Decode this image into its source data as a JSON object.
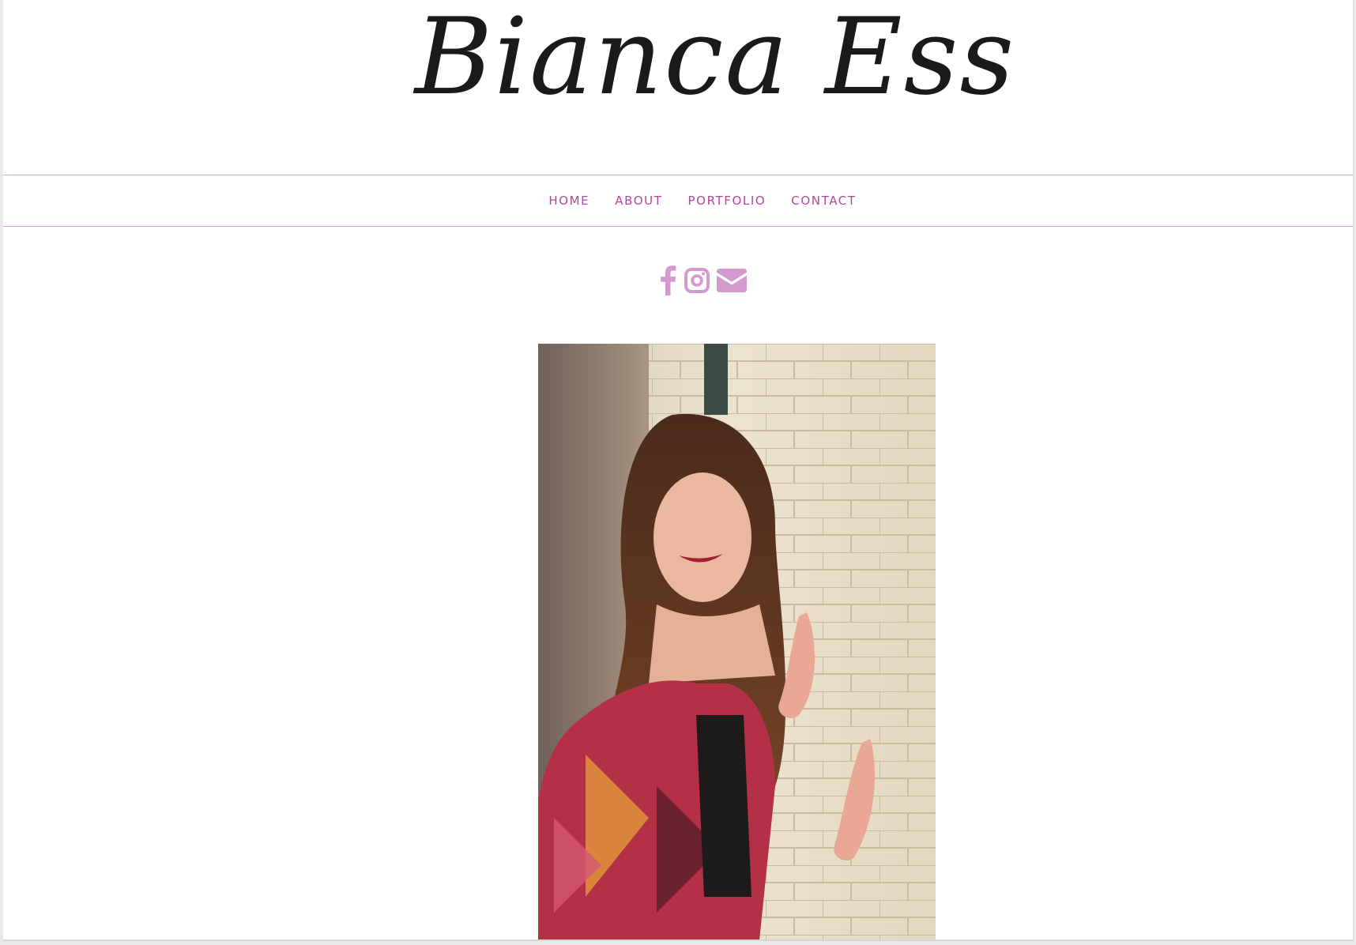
{
  "site": {
    "title": "Bianca Ess"
  },
  "nav": {
    "items": [
      {
        "label": "HOME"
      },
      {
        "label": "ABOUT"
      },
      {
        "label": "PORTFOLIO"
      },
      {
        "label": "CONTACT"
      }
    ]
  },
  "social": {
    "icons": [
      "facebook-icon",
      "instagram-icon",
      "email-icon"
    ]
  },
  "colors": {
    "nav_text": "#b0479e",
    "nav_border": "#d9a2d6",
    "icon": "#d39bcd",
    "title_text": "#1a1a1a",
    "background": "#ffffff"
  }
}
